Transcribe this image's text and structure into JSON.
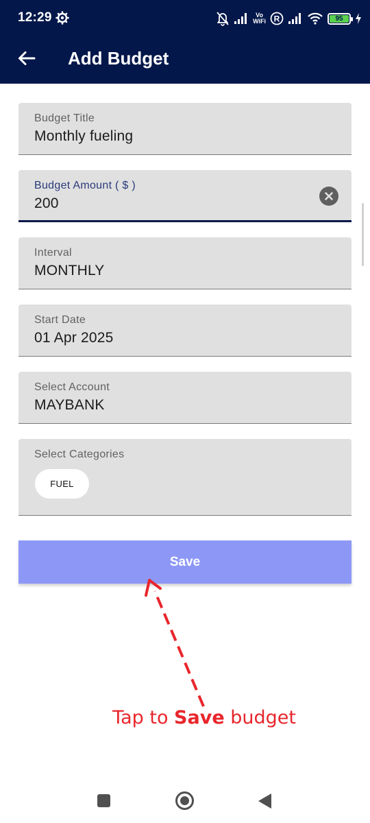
{
  "status_bar": {
    "time": "12:29",
    "vo_wifi": [
      "Vo",
      "WiFi"
    ],
    "battery_level": "95",
    "icons": [
      "gear-icon",
      "bell-off-icon",
      "signal-icon",
      "vowifi-icon",
      "roaming-icon",
      "signal-icon",
      "wifi-icon",
      "battery-icon",
      "charging-icon"
    ]
  },
  "app_bar": {
    "title": "Add Budget",
    "back_icon": "arrow-left-icon"
  },
  "form": {
    "budget_title": {
      "label": "Budget Title",
      "value": "Monthly fueling"
    },
    "budget_amount": {
      "label": "Budget Amount ( $ )",
      "value": "200",
      "clear_icon": "clear-circle-icon"
    },
    "interval": {
      "label": "Interval",
      "value": "MONTHLY"
    },
    "start_date": {
      "label": "Start Date",
      "value": "01 Apr 2025"
    },
    "account": {
      "label": "Select Account",
      "value": "MAYBANK"
    },
    "categories": {
      "label": "Select Categories",
      "chips": [
        "FUEL"
      ]
    }
  },
  "save_label": "Save",
  "annotation": {
    "prefix": "Tap to ",
    "emphasis": "Save",
    "suffix": " budget"
  },
  "colors": {
    "app_bar": "#03174a",
    "field_bg": "#e0e0e0",
    "save_button": "#8d98f6",
    "annotation": "#e8262c",
    "battery": "#5ad04e"
  },
  "nav_bar": {
    "icons": [
      "recents-square-icon",
      "home-circle-icon",
      "back-triangle-icon"
    ]
  }
}
